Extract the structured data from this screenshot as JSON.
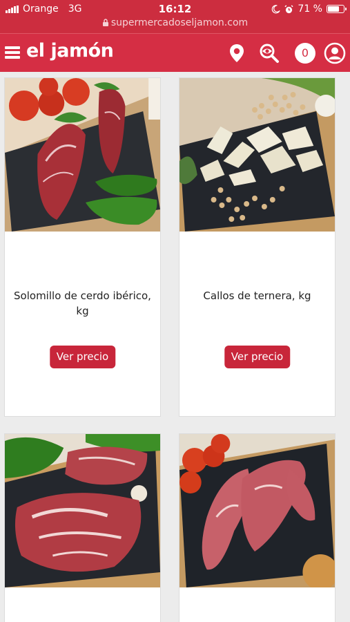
{
  "status": {
    "carrier": "Orange",
    "network": "3G",
    "time": "16:12",
    "battery_pct": "71 %",
    "battery_level": 0.71,
    "url": "supermercadoseljamon.com"
  },
  "navbar": {
    "brand": "el jamón",
    "cart_count": "0"
  },
  "products": [
    {
      "name": "Solomillo de cerdo ibérico, kg",
      "button": "Ver precio"
    },
    {
      "name": "Callos de ternera, kg",
      "button": "Ver precio"
    },
    {
      "name": "",
      "button": ""
    },
    {
      "name": "",
      "button": ""
    }
  ],
  "colors": {
    "brand_red": "#d52e44",
    "button_red": "#c8263a"
  }
}
